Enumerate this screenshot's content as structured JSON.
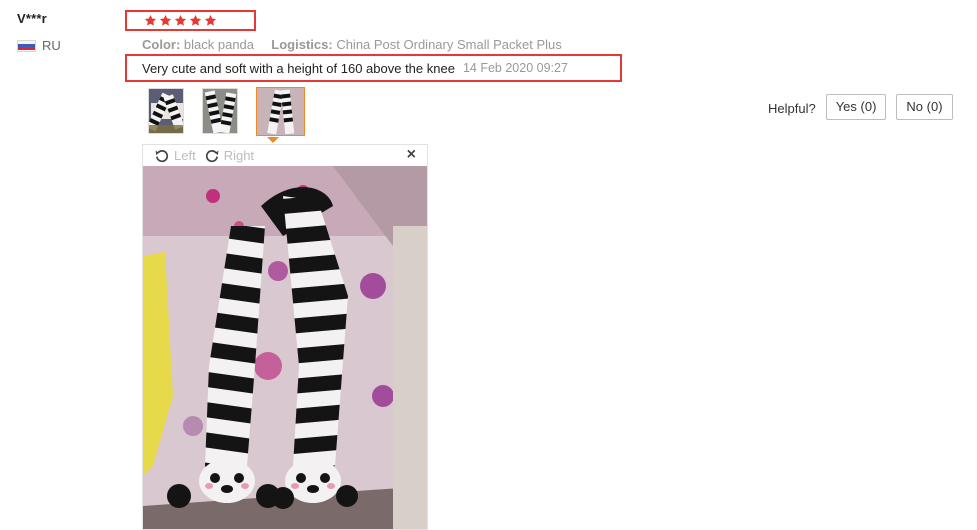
{
  "user": {
    "name": "V***r",
    "country": "RU"
  },
  "rating": {
    "stars": 5,
    "max": 5,
    "color": "#e53935"
  },
  "meta": {
    "color_label": "Color:",
    "color_value": "black panda",
    "logistics_label": "Logistics:",
    "logistics_value": "China Post Ordinary Small Packet Plus"
  },
  "review": {
    "text": "Very cute and soft with a height of 160 above the knee",
    "date": "14 Feb 2020 09:27"
  },
  "helpful": {
    "label": "Helpful?",
    "yes_label": "Yes (0)",
    "no_label": "No (0)"
  },
  "viewer": {
    "left_label": "Left",
    "right_label": "Right",
    "close_label": "×"
  },
  "thumbnails": [
    {
      "name": "photo-1",
      "active": false
    },
    {
      "name": "photo-2",
      "active": false
    },
    {
      "name": "photo-3",
      "active": true
    }
  ],
  "colors": {
    "highlight_border": "#e53935",
    "active_thumb": "#f08a24"
  }
}
